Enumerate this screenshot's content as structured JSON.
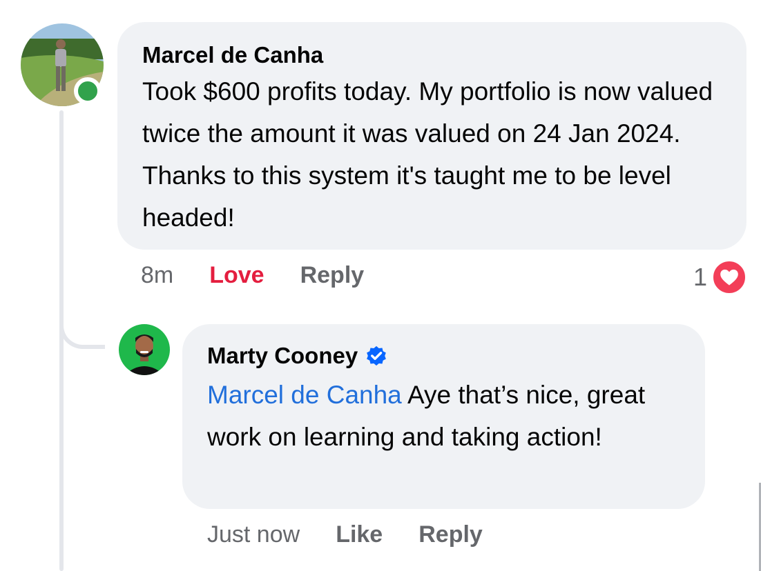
{
  "comment": {
    "author": "Marcel de Canha",
    "text": "Took $600 profits today. My portfolio is now valued twice the amount it was valued on 24 Jan 2024. Thanks to this system it's taught me to be level headed!",
    "time": "8m",
    "reaction_action": "Love",
    "reply_label": "Reply",
    "reaction_count": "1",
    "presence_status": "online",
    "reply": {
      "author": "Marty Cooney",
      "verified": true,
      "mention": "Marcel de Canha",
      "text": " Aye that’s nice, great work on learning and taking action!",
      "time": "Just now",
      "like_label": "Like",
      "reply_label": "Reply"
    }
  },
  "colors": {
    "bubble": "#f0f2f5",
    "love_red": "#e41e3f",
    "mention_blue": "#216fdb",
    "verified_blue": "#0866ff",
    "presence_green": "#31a24c",
    "meta_gray": "#65676b"
  }
}
